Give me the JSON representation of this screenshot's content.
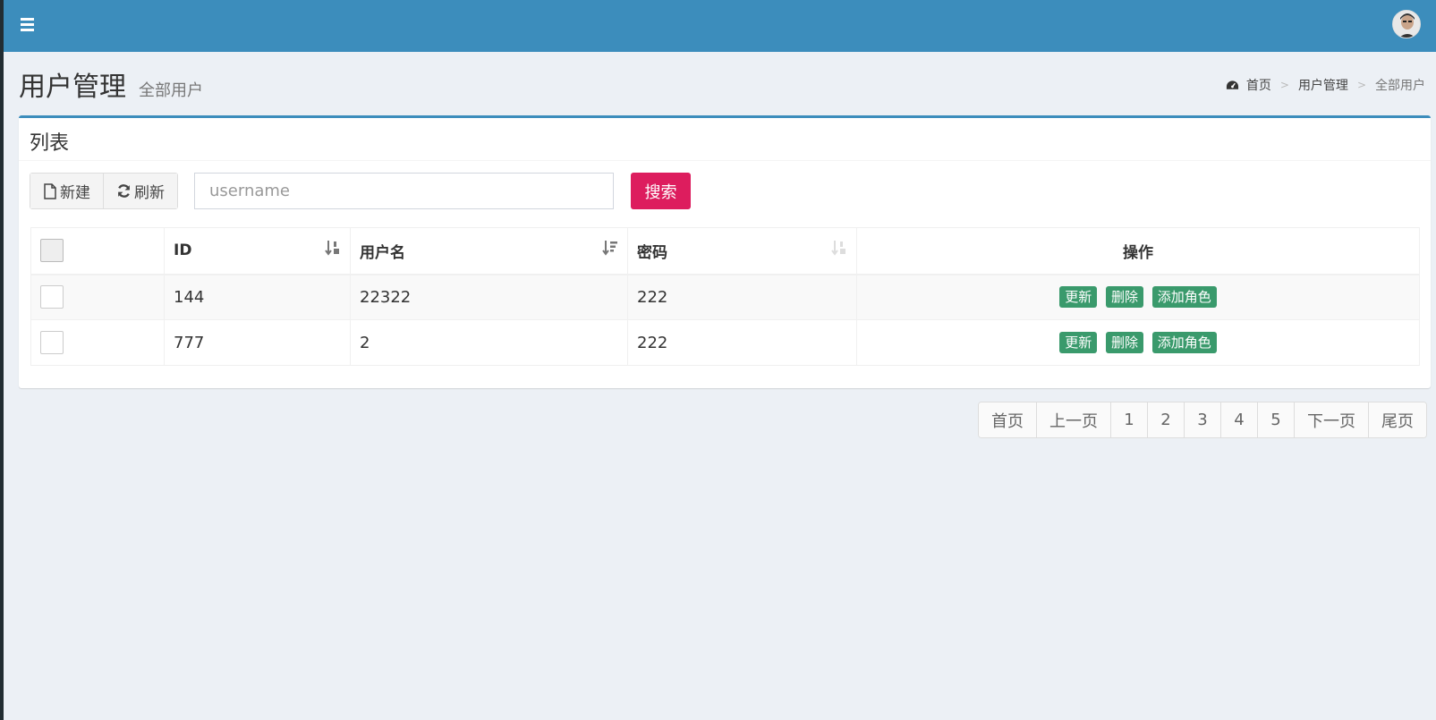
{
  "header": {
    "menu_icon": "hamburger-icon",
    "avatar_icon": "user-avatar"
  },
  "page": {
    "title": "用户管理",
    "subtitle": "全部用户"
  },
  "breadcrumb": {
    "home": "首页",
    "section": "用户管理",
    "current": "全部用户",
    "separator": ">"
  },
  "box": {
    "title": "列表"
  },
  "toolbar": {
    "new_label": "新建",
    "refresh_label": "刷新",
    "search_placeholder": "username",
    "search_value": "",
    "search_label": "搜索"
  },
  "table": {
    "columns": [
      "ID",
      "用户名",
      "密码",
      "操作"
    ],
    "rows": [
      {
        "id": "144",
        "username": "22322",
        "password": "222"
      },
      {
        "id": "777",
        "username": "2",
        "password": "222"
      }
    ],
    "actions": {
      "update": "更新",
      "delete": "删除",
      "add_role": "添加角色"
    }
  },
  "pagination": {
    "first": "首页",
    "prev": "上一页",
    "pages": [
      "1",
      "2",
      "3",
      "4",
      "5"
    ],
    "next": "下一页",
    "last": "尾页"
  },
  "colors": {
    "header_bg": "#3c8dbc",
    "search_button": "#dd1d5e",
    "action_button": "#3a9a6c",
    "page_bg": "#ecf0f5"
  }
}
